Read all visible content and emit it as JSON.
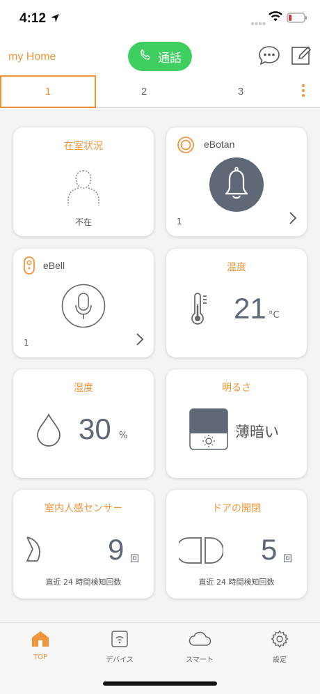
{
  "status": {
    "time": "4:12"
  },
  "header": {
    "home_title": "my Home",
    "call_label": "通話"
  },
  "tabs": [
    {
      "label": "1"
    },
    {
      "label": "2"
    },
    {
      "label": "3"
    }
  ],
  "cards": {
    "presence": {
      "title": "在室状況",
      "status": "不在"
    },
    "ebotan": {
      "name": "eBotan",
      "count": "1"
    },
    "ebell": {
      "name": "eBell",
      "count": "1"
    },
    "temperature": {
      "title": "温度",
      "value": "21",
      "unit": "°C"
    },
    "humidity": {
      "title": "湿度",
      "value": "30",
      "unit": "%"
    },
    "brightness": {
      "title": "明るさ",
      "value": "薄暗い"
    },
    "motion": {
      "title": "室内人感センサー",
      "value": "9",
      "unit": "回",
      "footer": "直近 24 時間検知回数"
    },
    "door": {
      "title": "ドアの開閉",
      "value": "5",
      "unit": "回",
      "footer": "直近 24 時間検知回数"
    }
  },
  "nav": [
    {
      "label": "TOP",
      "icon": "home-icon"
    },
    {
      "label": "デバイス",
      "icon": "device-icon"
    },
    {
      "label": "スマート",
      "icon": "cloud-icon"
    },
    {
      "label": "設定",
      "icon": "gear-icon"
    }
  ],
  "colors": {
    "accent": "#f0953a",
    "call": "#3fcf61",
    "icon": "#5f6877"
  }
}
